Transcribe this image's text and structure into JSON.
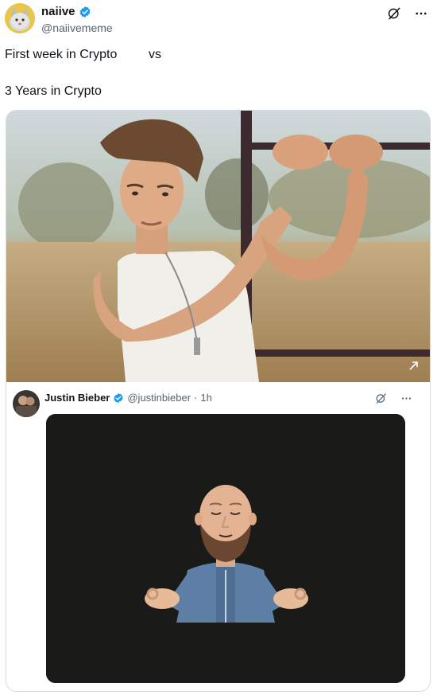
{
  "author": {
    "display_name": "naiive",
    "handle": "@naiivememe"
  },
  "tweet": {
    "line1_left": "First week in Crypto",
    "line1_right": "vs",
    "line2": "3 Years in Crypto"
  },
  "quoted": {
    "display_name": "Justin Bieber",
    "handle": "@justinbieber",
    "separator": "·",
    "time": "1h"
  },
  "colors": {
    "verified": "#1d9bf0",
    "muted_text": "#536471",
    "video_bg": "#1a1b19"
  },
  "icons": [
    "grok-icon",
    "more-icon",
    "verified-badge-icon"
  ]
}
